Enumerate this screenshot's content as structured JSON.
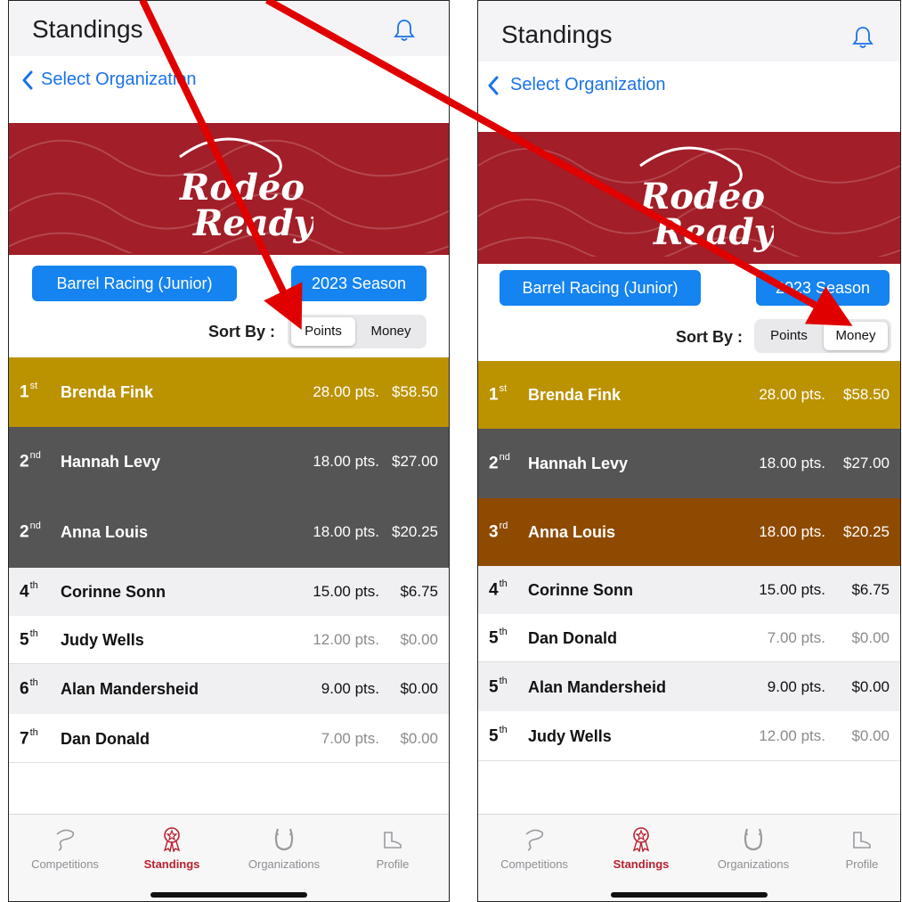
{
  "screens": [
    {
      "title": "Standings",
      "back_label": "Select Organization",
      "banner_logo": [
        "Rodeo",
        "Ready"
      ],
      "event_button": "Barrel Racing (Junior)",
      "season_button": "2023 Season",
      "sort_label": "Sort By :",
      "sort_options": [
        "Points",
        "Money"
      ],
      "sort_selected": "Points",
      "rows": [
        {
          "rank": "1",
          "suffix": "st",
          "name": "Brenda Fink",
          "points": "28.00 pts.",
          "money": "$58.50",
          "style": "gold"
        },
        {
          "rank": "2",
          "suffix": "nd",
          "name": "Hannah Levy",
          "points": "18.00 pts.",
          "money": "$27.00",
          "style": "silver"
        },
        {
          "rank": "2",
          "suffix": "nd",
          "name": "Anna Louis",
          "points": "18.00 pts.",
          "money": "$20.25",
          "style": "silver"
        },
        {
          "rank": "4",
          "suffix": "th",
          "name": "Corinne Sonn",
          "points": "15.00 pts.",
          "money": "$6.75",
          "style": "alt"
        },
        {
          "rank": "5",
          "suffix": "th",
          "name": "Judy Wells",
          "points": "12.00 pts.",
          "money": "$0.00",
          "style": "plain"
        },
        {
          "rank": "6",
          "suffix": "th",
          "name": "Alan Mandersheid",
          "points": "9.00 pts.",
          "money": "$0.00",
          "style": "alt"
        },
        {
          "rank": "7",
          "suffix": "th",
          "name": "Dan Donald",
          "points": "7.00 pts.",
          "money": "$0.00",
          "style": "plain"
        }
      ]
    },
    {
      "title": "Standings",
      "back_label": "Select Organization",
      "banner_logo": [
        "Rodeo",
        "Ready"
      ],
      "event_button": "Barrel Racing (Junior)",
      "season_button": "2023 Season",
      "sort_label": "Sort By :",
      "sort_options": [
        "Points",
        "Money"
      ],
      "sort_selected": "Money",
      "rows": [
        {
          "rank": "1",
          "suffix": "st",
          "name": "Brenda Fink",
          "points": "28.00 pts.",
          "money": "$58.50",
          "style": "gold"
        },
        {
          "rank": "2",
          "suffix": "nd",
          "name": "Hannah Levy",
          "points": "18.00 pts.",
          "money": "$27.00",
          "style": "silver"
        },
        {
          "rank": "3",
          "suffix": "rd",
          "name": "Anna Louis",
          "points": "18.00 pts.",
          "money": "$20.25",
          "style": "bronze"
        },
        {
          "rank": "4",
          "suffix": "th",
          "name": "Corinne Sonn",
          "points": "15.00 pts.",
          "money": "$6.75",
          "style": "alt"
        },
        {
          "rank": "5",
          "suffix": "th",
          "name": "Dan Donald",
          "points": "7.00 pts.",
          "money": "$0.00",
          "style": "plain"
        },
        {
          "rank": "5",
          "suffix": "th",
          "name": "Alan Mandersheid",
          "points": "9.00 pts.",
          "money": "$0.00",
          "style": "alt"
        },
        {
          "rank": "5",
          "suffix": "th",
          "name": "Judy Wells",
          "points": "12.00 pts.",
          "money": "$0.00",
          "style": "plain"
        }
      ]
    }
  ],
  "tabs": [
    {
      "label": "Competitions",
      "icon": "lasso-icon",
      "active": false
    },
    {
      "label": "Standings",
      "icon": "ribbon-award-icon",
      "active": true
    },
    {
      "label": "Organizations",
      "icon": "horseshoe-icon",
      "active": false
    },
    {
      "label": "Profile",
      "icon": "boot-icon",
      "active": false
    }
  ],
  "colors": {
    "accent_blue": "#1583f0",
    "banner_red": "#a21e28",
    "gold": "#bb9200",
    "silver": "#555555",
    "bronze": "#8e4a00",
    "tab_active": "#b8202e",
    "arrow_red": "#e00000"
  }
}
